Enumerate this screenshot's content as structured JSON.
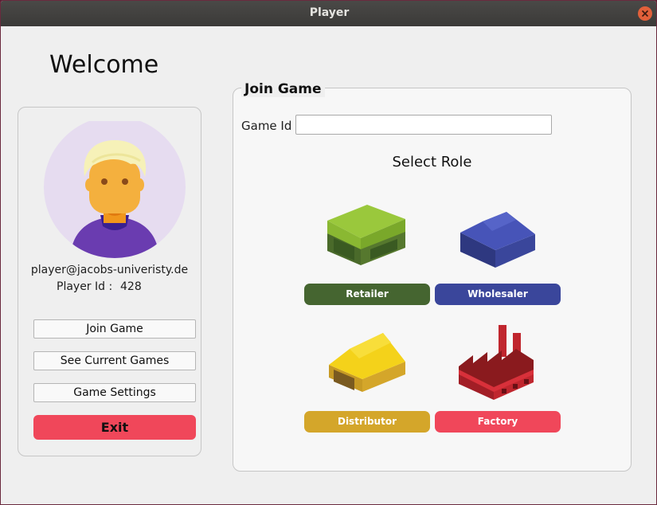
{
  "window": {
    "title": "Player"
  },
  "welcome": "Welcome",
  "profile": {
    "email": "player@jacobs-univeristy.de",
    "player_id_label": "Player Id :",
    "player_id": "428"
  },
  "menu": {
    "join_game": "Join Game",
    "see_current_games": "See Current Games",
    "game_settings": "Game Settings",
    "exit": "Exit"
  },
  "join": {
    "legend": "Join Game",
    "game_id_label": "Game Id",
    "game_id_value": "",
    "select_role": "Select Role",
    "roles": [
      {
        "label": "Retailer",
        "color": "#456530",
        "icon": "retailer-building-icon"
      },
      {
        "label": "Wholesaler",
        "color": "#3a469b",
        "icon": "wholesaler-building-icon"
      },
      {
        "label": "Distributor",
        "color": "#d4a62a",
        "icon": "distributor-building-icon"
      },
      {
        "label": "Factory",
        "color": "#f0475a",
        "icon": "factory-building-icon"
      }
    ]
  }
}
